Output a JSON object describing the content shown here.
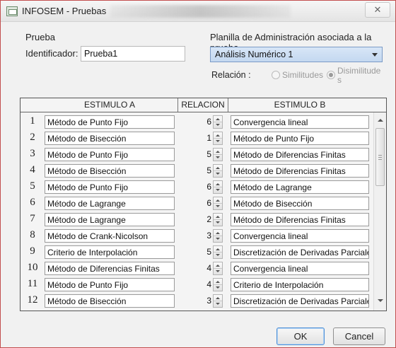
{
  "window": {
    "title": "INFOSEM - Pruebas",
    "close_symbol": "✕"
  },
  "prueba": {
    "group_label": "Prueba",
    "identificador_label": "Identificador:",
    "identificador_value": "Prueba1"
  },
  "planilla": {
    "label": "Planilla de Administración asociada a la prueba",
    "selected": "Análisis Numérico 1",
    "relacion_label": "Relación :",
    "options": [
      "Similitudes",
      "Disimilitudes"
    ],
    "selected_option": "Disimilitudes"
  },
  "table": {
    "headers": [
      "ESTIMULO A",
      "RELACION",
      "ESTIMULO B"
    ],
    "rows": [
      {
        "n": "1",
        "a": "Método de Punto Fijo",
        "rel": "6",
        "b": "Convergencia lineal"
      },
      {
        "n": "2",
        "a": "Método de Bisección",
        "rel": "1",
        "b": "Método de Punto Fijo"
      },
      {
        "n": "3",
        "a": "Método de Punto Fijo",
        "rel": "5",
        "b": "Método de Diferencias Finitas"
      },
      {
        "n": "4",
        "a": "Método de Bisección",
        "rel": "5",
        "b": "Método de Diferencias Finitas"
      },
      {
        "n": "5",
        "a": "Método de Punto Fijo",
        "rel": "6",
        "b": "Método de Lagrange"
      },
      {
        "n": "6",
        "a": "Método de Lagrange",
        "rel": "6",
        "b": "Método de Bisección"
      },
      {
        "n": "7",
        "a": "Método de Lagrange",
        "rel": "2",
        "b": "Método de Diferencias Finitas"
      },
      {
        "n": "8",
        "a": "Método de Crank-Nicolson",
        "rel": "3",
        "b": "Convergencia lineal"
      },
      {
        "n": "9",
        "a": "Criterio de Interpolación",
        "rel": "5",
        "b": "Discretización de Derivadas Parciales"
      },
      {
        "n": "10",
        "a": "Método de Diferencias Finitas",
        "rel": "4",
        "b": "Convergencia lineal"
      },
      {
        "n": "11",
        "a": "Método de Punto Fijo",
        "rel": "4",
        "b": "Criterio de Interpolación"
      },
      {
        "n": "12",
        "a": "Método de Bisección",
        "rel": "3",
        "b": "Discretización de Derivadas Parciales"
      }
    ]
  },
  "buttons": {
    "ok": "OK",
    "cancel": "Cancel"
  },
  "icons": [
    "app-window-icon",
    "close-icon",
    "chevron-down-icon",
    "spin-up-down-icon",
    "scroll-up-icon",
    "scroll-down-icon"
  ],
  "colors": {
    "window_border": "#c24f4f",
    "dropdown_bg": "#c4d8f0",
    "ok_border": "#4d8fd6"
  }
}
